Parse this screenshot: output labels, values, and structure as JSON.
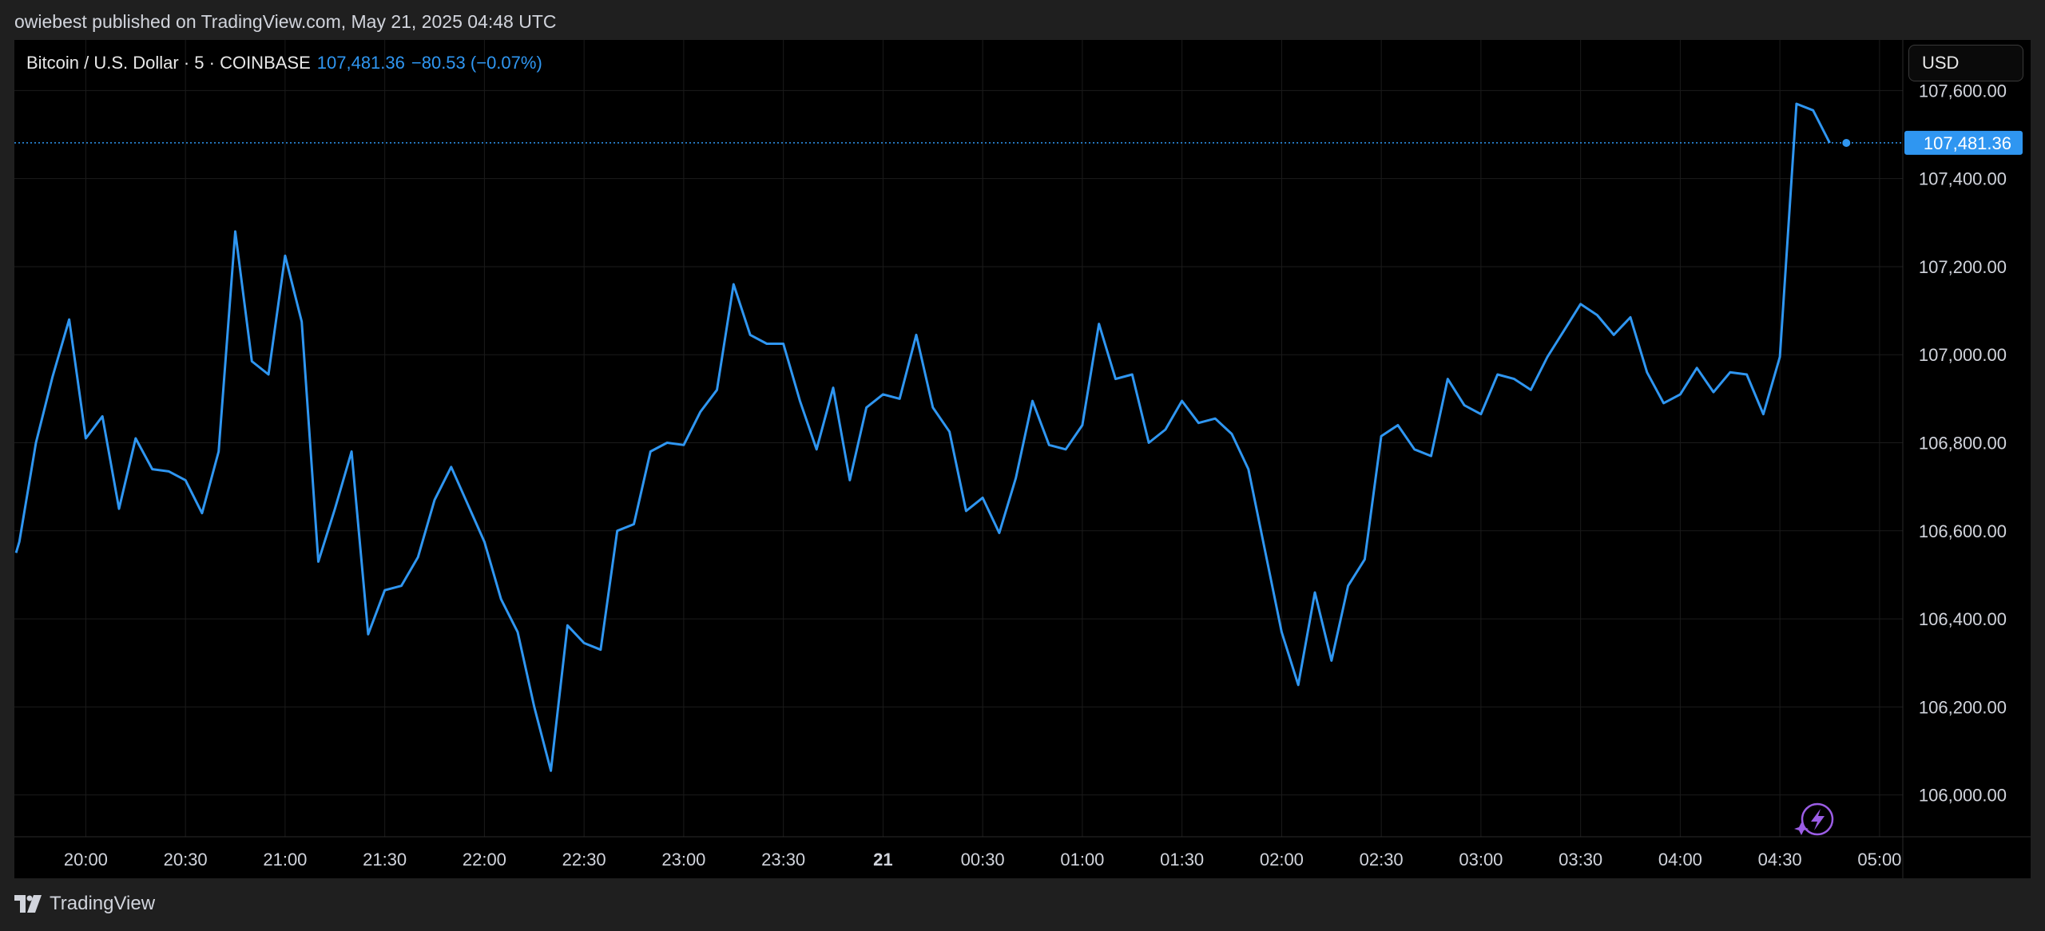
{
  "header": {
    "credit": "owiebest published on TradingView.com, May 21, 2025 04:48 UTC"
  },
  "legend": {
    "symbol": "Bitcoin / U.S. Dollar · 5 · COINBASE",
    "last": "107,481.36",
    "change": "−80.53 (−0.07%)"
  },
  "currency": {
    "label": "USD"
  },
  "footer": {
    "logo_text": "TradingView",
    "logo_icon": "tradingview-logo-icon"
  },
  "colors": {
    "line": "#2f96f1",
    "background": "#000000",
    "frame": "#1f1f1f",
    "grid": "#1b1b1b",
    "text": "#d1d4dc",
    "price_label_bg": "#2f96f1",
    "lightning": "#9b5de5"
  },
  "icons": {
    "corner_button": "lightning-icon"
  },
  "chart_data": {
    "type": "line",
    "title": "",
    "xlabel": "",
    "ylabel": "",
    "x_tick_labels": [
      "20:00",
      "20:30",
      "21:00",
      "21:30",
      "22:00",
      "22:30",
      "23:00",
      "23:30",
      "21",
      "00:30",
      "01:00",
      "01:30",
      "02:00",
      "02:30",
      "03:00",
      "03:30",
      "04:00",
      "04:30",
      "05:00"
    ],
    "x_tick_minutes": [
      1200,
      1230,
      1260,
      1290,
      1320,
      1350,
      1380,
      1410,
      1440,
      1470,
      1500,
      1530,
      1560,
      1590,
      1620,
      1650,
      1680,
      1710,
      1740
    ],
    "y_tick_labels": [
      "107,600.00",
      "107,400.00",
      "107,200.00",
      "107,000.00",
      "106,800.00",
      "106,600.00",
      "106,400.00",
      "106,200.00",
      "106,000.00"
    ],
    "y_ticks": [
      107600,
      107400,
      107200,
      107000,
      106800,
      106600,
      106400,
      106200,
      106000
    ],
    "ylim": [
      105905,
      107715
    ],
    "x_range_minutes": [
      1178.5,
      1747
    ],
    "current_price": 107481.36,
    "current_price_label": "107,481.36",
    "grid": true,
    "series": [
      {
        "x_minutes": [
          1179,
          1180,
          1185,
          1190,
          1195,
          1200,
          1205,
          1210,
          1215,
          1220,
          1225,
          1230,
          1235,
          1240,
          1245,
          1250,
          1255,
          1260,
          1265,
          1270,
          1275,
          1280,
          1285,
          1290,
          1295,
          1300,
          1305,
          1310,
          1315,
          1320,
          1325,
          1330,
          1335,
          1340,
          1345,
          1350,
          1355,
          1360,
          1365,
          1370,
          1375,
          1380,
          1385,
          1390,
          1395,
          1400,
          1405,
          1410,
          1415,
          1420,
          1425,
          1430,
          1435,
          1440,
          1445,
          1450,
          1455,
          1460,
          1465,
          1470,
          1475,
          1480,
          1485,
          1490,
          1495,
          1500,
          1505,
          1510,
          1515,
          1520,
          1525,
          1530,
          1535,
          1540,
          1545,
          1550,
          1555,
          1560,
          1565,
          1570,
          1575,
          1580,
          1585,
          1590,
          1595,
          1600,
          1605,
          1610,
          1615,
          1620,
          1625,
          1630,
          1635,
          1640,
          1645,
          1650,
          1655,
          1660,
          1665,
          1670,
          1675,
          1680,
          1685,
          1690,
          1695,
          1700,
          1705,
          1710,
          1715,
          1720,
          1725,
          1730
        ],
        "y": [
          106550,
          106575,
          106800,
          106950,
          107080,
          106810,
          106860,
          106650,
          106810,
          106740,
          106735,
          106715,
          106640,
          106780,
          107280,
          106985,
          106955,
          107225,
          107075,
          106530,
          106650,
          106780,
          106365,
          106465,
          106475,
          106540,
          106670,
          106745,
          106660,
          106575,
          106445,
          106370,
          106200,
          106055,
          106385,
          106345,
          106330,
          106600,
          106615,
          106780,
          106800,
          106795,
          106870,
          106920,
          107160,
          107045,
          107025,
          107025,
          106895,
          106785,
          106925,
          106715,
          106880,
          106910,
          106900,
          107045,
          106880,
          106825,
          106645,
          106675,
          106595,
          106720,
          106895,
          106795,
          106785,
          106840,
          107070,
          106945,
          106955,
          106800,
          106830,
          106895,
          106845,
          106855,
          106820,
          106740,
          106555,
          106370,
          106250,
          106460,
          106305,
          106475,
          106535,
          106815,
          106840,
          106785,
          106770,
          106945,
          106885,
          106865,
          106955,
          106945,
          106920,
          106995,
          107055,
          107115,
          107090,
          107045,
          107085,
          106960,
          106890,
          106910,
          106970,
          106915,
          106960,
          106955,
          106865,
          106995,
          107570,
          107555,
          107481
        ]
      }
    ]
  }
}
